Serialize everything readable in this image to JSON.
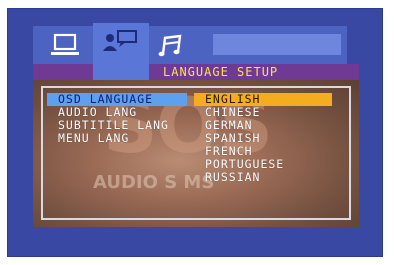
{
  "title": "LANGUAGE SETUP",
  "tabs": [
    {
      "icon": "monitor-icon"
    },
    {
      "icon": "speaker-icon"
    },
    {
      "icon": "music-note-icon"
    }
  ],
  "watermark": {
    "big": "SOS",
    "small": "AUDIO S     MS"
  },
  "left_menu": [
    {
      "label": "OSD LANGUAGE",
      "selected": true
    },
    {
      "label": "AUDIO LANG",
      "selected": false
    },
    {
      "label": "SUBTITILE LANG",
      "selected": false
    },
    {
      "label": "MENU LANG",
      "selected": false
    }
  ],
  "right_menu": [
    {
      "label": "ENGLISH",
      "selected": true
    },
    {
      "label": "CHINESE",
      "selected": false
    },
    {
      "label": "GERMAN",
      "selected": false
    },
    {
      "label": "SPANISH",
      "selected": false
    },
    {
      "label": "FRENCH",
      "selected": false
    },
    {
      "label": "PORTUGUESE",
      "selected": false
    },
    {
      "label": "RUSSIAN",
      "selected": false
    }
  ],
  "colors": {
    "screen_bg": "#3848a3",
    "title_bar": "#6f3a94",
    "title_text": "#ffe24a",
    "left_highlight": "#5fa0ee",
    "right_highlight": "#f4ad1f"
  }
}
